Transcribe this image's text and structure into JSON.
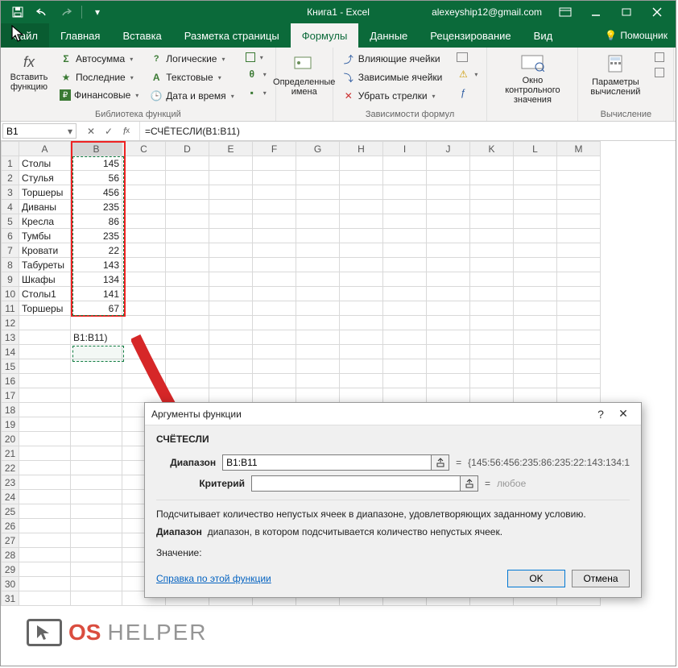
{
  "titlebar": {
    "title": "Книга1 - Excel",
    "user": "alexeyship12@gmail.com"
  },
  "tabs": {
    "file": "Файл",
    "items": [
      "Главная",
      "Вставка",
      "Разметка страницы",
      "Формулы",
      "Данные",
      "Рецензирование",
      "Вид"
    ],
    "active_index": 3,
    "help": "Помощник"
  },
  "ribbon": {
    "insert_fn": "Вставить функцию",
    "lib": {
      "autosum": "Автосумма",
      "recent": "Последние",
      "financial": "Финансовые",
      "logical": "Логические",
      "text": "Текстовые",
      "datetime": "Дата и время",
      "group_title": "Библиотека функций"
    },
    "defined": {
      "label": "Определенные имена"
    },
    "deps": {
      "trace_prec": "Влияющие ячейки",
      "trace_dep": "Зависимые ячейки",
      "remove": "Убрать стрелки",
      "group_title": "Зависимости формул"
    },
    "watch": "Окно контрольного значения",
    "calc": {
      "label": "Параметры вычислений",
      "group_title": "Вычисление"
    }
  },
  "namebox": "B1",
  "formula": "=СЧЁТЕСЛИ(B1:B11)",
  "columns": [
    "A",
    "B",
    "C",
    "D",
    "E",
    "F",
    "G",
    "H",
    "I",
    "J",
    "K",
    "L",
    "M"
  ],
  "rows": [
    {
      "n": 1,
      "a": "Столы",
      "b": 145
    },
    {
      "n": 2,
      "a": "Стулья",
      "b": 56
    },
    {
      "n": 3,
      "a": "Торшеры",
      "b": 456
    },
    {
      "n": 4,
      "a": "Диваны",
      "b": 235
    },
    {
      "n": 5,
      "a": "Кресла",
      "b": 86
    },
    {
      "n": 6,
      "a": "Тумбы",
      "b": 235
    },
    {
      "n": 7,
      "a": "Кровати",
      "b": 22
    },
    {
      "n": 8,
      "a": "Табуреты",
      "b": 143
    },
    {
      "n": 9,
      "a": "Шкафы",
      "b": 134
    },
    {
      "n": 10,
      "a": "Столы1",
      "b": 141
    },
    {
      "n": 11,
      "a": "Торшеры",
      "b": 67
    }
  ],
  "edit_cell": "B1:B11)",
  "dialog": {
    "title": "Аргументы функции",
    "func": "СЧЁТЕСЛИ",
    "arg1_label": "Диапазон",
    "arg1_value": "B1:B11",
    "arg1_result": "{145:56:456:235:86:235:22:143:134:1",
    "arg2_label": "Критерий",
    "arg2_value": "",
    "arg2_result": "любое",
    "desc": "Подсчитывает количество непустых ячеек в диапазоне, удовлетворяющих заданному условию.",
    "arg_name": "Диапазон",
    "arg_desc": "диапазон, в котором подсчитывается количество непустых ячеек.",
    "result_label": "Значение:",
    "help_link": "Справка по этой функции",
    "ok": "OK",
    "cancel": "Отмена"
  },
  "watermark": {
    "t1": "OS",
    "t2": "HELPER"
  }
}
